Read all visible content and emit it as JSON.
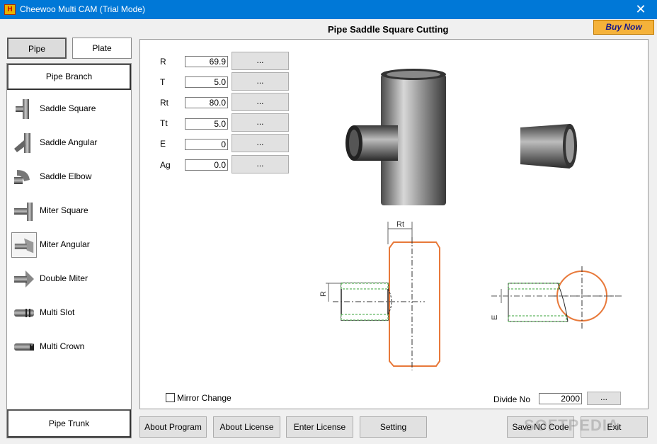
{
  "window": {
    "title": "Cheewoo Multi CAM (Trial Mode)",
    "close_glyph": "✕",
    "app_icon": "app-logo-icon"
  },
  "tabs": {
    "pipe": "Pipe",
    "plate": "Plate"
  },
  "left_panel": {
    "branch_label": "Pipe Branch",
    "items": [
      {
        "label": "Saddle Square",
        "icon": "saddle-square-icon"
      },
      {
        "label": "Saddle Angular",
        "icon": "saddle-angular-icon"
      },
      {
        "label": "Saddle Elbow",
        "icon": "saddle-elbow-icon"
      },
      {
        "label": "Miter Square",
        "icon": "miter-square-icon"
      },
      {
        "label": "Miter Angular",
        "icon": "miter-angular-icon"
      },
      {
        "label": "Double Miter",
        "icon": "double-miter-icon"
      },
      {
        "label": "Multi Slot",
        "icon": "multi-slot-icon"
      },
      {
        "label": "Multi Crown",
        "icon": "multi-crown-icon"
      }
    ],
    "trunk_label": "Pipe Trunk"
  },
  "header": {
    "title": "Pipe  Saddle Square Cutting",
    "buy_now": "Buy Now"
  },
  "params": [
    {
      "label": "R",
      "value": "69.9",
      "button": "..."
    },
    {
      "label": "T",
      "value": "5.0",
      "button": "..."
    },
    {
      "label": "Rt",
      "value": "80.0",
      "button": "..."
    },
    {
      "label": "Tt",
      "value": "5.0",
      "button": "..."
    },
    {
      "label": "E",
      "value": "0",
      "button": "..."
    },
    {
      "label": "Ag",
      "value": "0.0",
      "button": "..."
    }
  ],
  "drawing_labels": {
    "rt": "Rt",
    "r": "R",
    "e": "E"
  },
  "colors": {
    "accent": "#0078d7",
    "outline": "#e8793a",
    "hatch": "#3aa33a",
    "buy_now": "#f5b23a"
  },
  "mirror_change": "Mirror Change",
  "divide": {
    "label": "Divide No",
    "value": "2000",
    "button": "..."
  },
  "buttons": {
    "about_program": "About Program",
    "about_license": "About License",
    "enter_license": "Enter License",
    "setting": "Setting",
    "save_nc": "Save NC Code",
    "exit": "Exit"
  },
  "watermark": "SOFTPEDIA"
}
